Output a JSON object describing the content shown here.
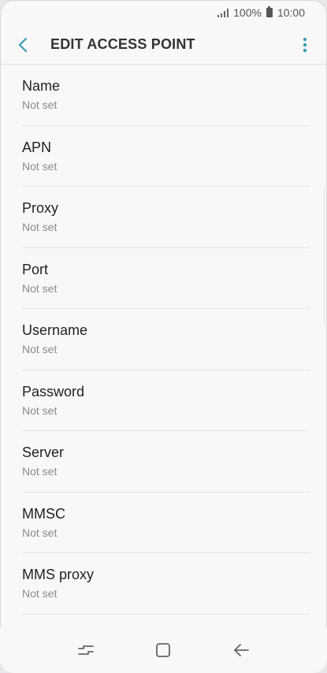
{
  "status_bar": {
    "battery_percent": "100%",
    "time": "10:00"
  },
  "header": {
    "title": "EDIT ACCESS POINT"
  },
  "fields": [
    {
      "label": "Name",
      "value": "Not set"
    },
    {
      "label": "APN",
      "value": "Not set"
    },
    {
      "label": "Proxy",
      "value": "Not set"
    },
    {
      "label": "Port",
      "value": "Not set"
    },
    {
      "label": "Username",
      "value": "Not set"
    },
    {
      "label": "Password",
      "value": "Not set"
    },
    {
      "label": "Server",
      "value": "Not set"
    },
    {
      "label": "MMSC",
      "value": "Not set"
    },
    {
      "label": "MMS proxy",
      "value": "Not set"
    }
  ],
  "colors": {
    "accent": "#3b9bb8",
    "text_primary": "#222222",
    "text_secondary": "#8a8a8a"
  },
  "icons": {
    "back": "chevron-left-icon",
    "menu": "more-vert-icon",
    "nav_recents": "recents-icon",
    "nav_home": "home-icon",
    "nav_back": "back-arrow-icon"
  }
}
